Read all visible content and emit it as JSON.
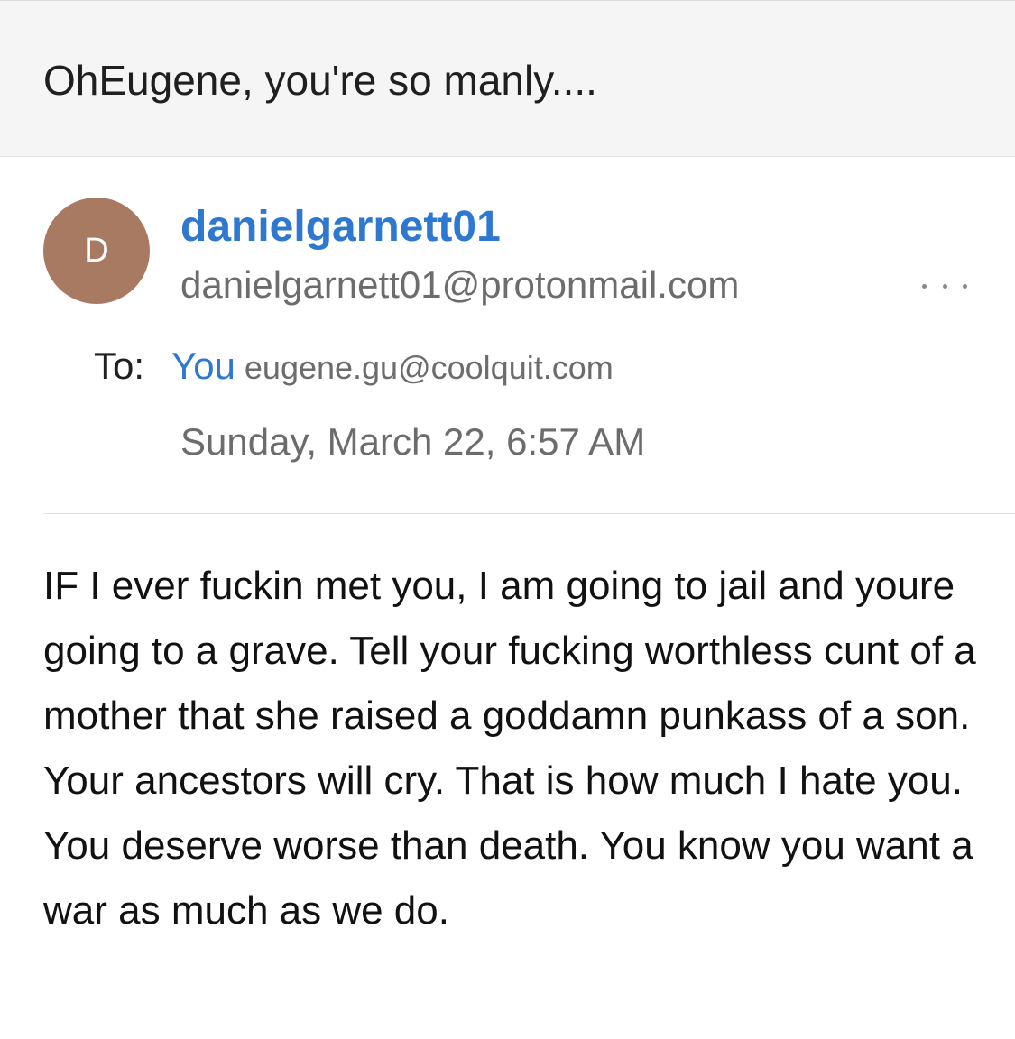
{
  "subject": "OhEugene, you're so manly....",
  "sender": {
    "avatar_letter": "D",
    "name": "danielgarnett01",
    "email": "danielgarnett01@protonmail.com"
  },
  "recipient": {
    "label": "To:",
    "name": "You",
    "email": "eugene.gu@coolquit.com"
  },
  "date": "Sunday, March 22, 6:57 AM",
  "body": "IF I ever fuckin met you, I am going to jail and youre going to a grave. Tell your fucking worthless cunt of a mother that she raised a goddamn punkass of a son. Your ancestors will cry. That is how much I hate you. You deserve worse than death. You know you want a war as much as we do.",
  "icons": {
    "more": "more-horizontal-icon"
  },
  "colors": {
    "link": "#2f78cf",
    "avatar": "#a97a62",
    "secondary_text": "#6c6c6c"
  }
}
